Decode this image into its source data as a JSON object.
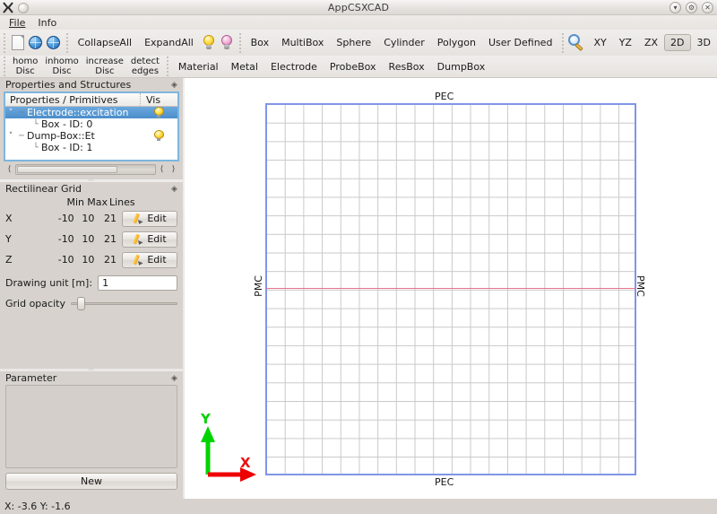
{
  "window": {
    "title": "AppCSXCAD",
    "buttons": [
      {
        "name": "shade-button",
        "glyph": "▾"
      },
      {
        "name": "settings-button",
        "glyph": "⚙"
      },
      {
        "name": "close-button",
        "glyph": "✕"
      }
    ]
  },
  "menubar": {
    "items": [
      {
        "name": "menu-file",
        "label": "File",
        "mnemonic": "F"
      },
      {
        "name": "menu-info",
        "label": "Info",
        "mnemonic": "I"
      }
    ]
  },
  "toolbar_top": {
    "items": [
      {
        "name": "new-document-button",
        "kind": "icon",
        "icon": "page-icon",
        "label": ""
      },
      {
        "name": "load-globe-button",
        "kind": "icon",
        "icon": "globe-icon",
        "label": ""
      },
      {
        "name": "save-globe-button",
        "kind": "icon",
        "icon": "globe-icon",
        "label": ""
      },
      {
        "name": "collapse-all-button",
        "kind": "text",
        "label": "CollapseAll"
      },
      {
        "name": "expand-all-button",
        "kind": "text",
        "label": "ExpandAll"
      },
      {
        "name": "show-all-button",
        "kind": "icon",
        "icon": "bulb-yellow-icon",
        "label": ""
      },
      {
        "name": "hide-all-button",
        "kind": "icon",
        "icon": "bulb-pink-icon",
        "label": ""
      },
      {
        "name": "box-button",
        "kind": "text",
        "label": "Box"
      },
      {
        "name": "multibox-button",
        "kind": "text",
        "label": "MultiBox"
      },
      {
        "name": "sphere-button",
        "kind": "text",
        "label": "Sphere"
      },
      {
        "name": "cylinder-button",
        "kind": "text",
        "label": "Cylinder"
      },
      {
        "name": "polygon-button",
        "kind": "text",
        "label": "Polygon"
      },
      {
        "name": "user-defined-button",
        "kind": "text",
        "label": "User Defined"
      },
      {
        "name": "zoom-button",
        "kind": "icon",
        "icon": "magnifier-icon",
        "label": ""
      },
      {
        "name": "view-xy-button",
        "kind": "text",
        "label": "XY"
      },
      {
        "name": "view-yz-button",
        "kind": "text",
        "label": "YZ"
      },
      {
        "name": "view-zx-button",
        "kind": "text",
        "label": "ZX"
      },
      {
        "name": "view-2d-button",
        "kind": "text",
        "label": "2D",
        "checked": true
      },
      {
        "name": "view-3d-button",
        "kind": "text",
        "label": "3D"
      }
    ]
  },
  "toolbar_second": {
    "items": [
      {
        "name": "homo-disc-button",
        "label": "homo\nDisc"
      },
      {
        "name": "inhomo-disc-button",
        "label": "inhomo\nDisc"
      },
      {
        "name": "increase-disc-button",
        "label": "increase\nDisc"
      },
      {
        "name": "detect-edges-button",
        "label": "detect\nedges"
      },
      {
        "name": "material-button",
        "label": "Material"
      },
      {
        "name": "metal-button",
        "label": "Metal"
      },
      {
        "name": "electrode-button",
        "label": "Electrode"
      },
      {
        "name": "probebox-button",
        "label": "ProbeBox"
      },
      {
        "name": "resbox-button",
        "label": "ResBox"
      },
      {
        "name": "dumpbox-button",
        "label": "DumpBox"
      }
    ]
  },
  "properties_dock": {
    "title": "Properties and Structures",
    "columns": [
      "Properties / Primitives",
      "Vis"
    ],
    "rows": [
      {
        "label": "Electrode::excitation",
        "indent": 0,
        "selected": true,
        "expander": "˅",
        "vis": true
      },
      {
        "label": "Box - ID: 0",
        "indent": 1,
        "selected": false,
        "expander": "",
        "vis": false
      },
      {
        "label": "Dump-Box::Et",
        "indent": 0,
        "selected": false,
        "expander": "˅",
        "vis": true
      },
      {
        "label": "Box - ID: 1",
        "indent": 1,
        "selected": false,
        "expander": "",
        "vis": false
      }
    ]
  },
  "grid_dock": {
    "title": "Rectilinear Grid",
    "headers": {
      "min": "Min",
      "max": "Max",
      "lines": "Lines"
    },
    "rows": [
      {
        "axis": "X",
        "min": "-10",
        "max": "10",
        "lines": "21",
        "edit_label": "Edit"
      },
      {
        "axis": "Y",
        "min": "-10",
        "max": "10",
        "lines": "21",
        "edit_label": "Edit"
      },
      {
        "axis": "Z",
        "min": "-10",
        "max": "10",
        "lines": "21",
        "edit_label": "Edit"
      }
    ],
    "drawing_unit_label": "Drawing unit [m]:",
    "drawing_unit_value": "1",
    "grid_opacity_label": "Grid opacity",
    "grid_opacity_percent": 6
  },
  "parameter_dock": {
    "title": "Parameter",
    "new_button_label": "New"
  },
  "statusbar": {
    "coords": "X: -3.6  Y: -1.6"
  },
  "canvas": {
    "labels": {
      "top": "PEC",
      "bottom": "PEC",
      "left": "PMC",
      "right": "PMC"
    },
    "axes": {
      "y_label": "Y",
      "y_color": "#00d000",
      "x_label": "X",
      "x_color": "#e81010"
    },
    "boundary_color": "#8096e8",
    "grid_line_color": "#c9c9c9",
    "pmc_line_color": "#e8738f",
    "grid_cells": 20
  }
}
